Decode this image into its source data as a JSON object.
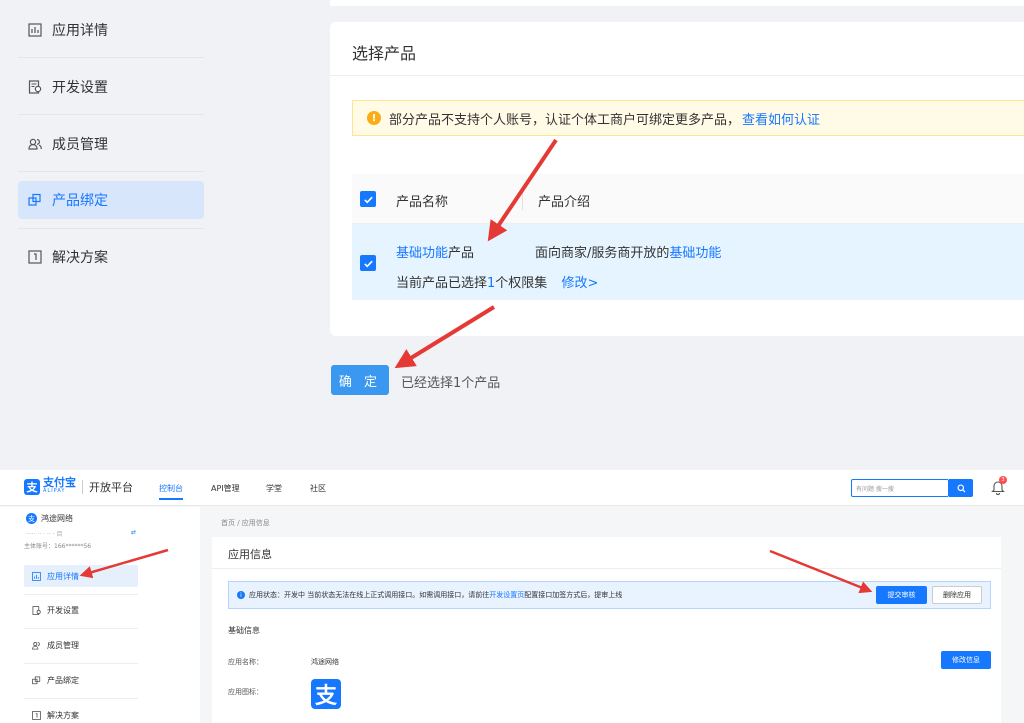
{
  "top": {
    "sidebar": [
      {
        "label": "应用详情",
        "icon": "chart-box-icon",
        "active": false
      },
      {
        "label": "开发设置",
        "icon": "settings-doc-icon",
        "active": false
      },
      {
        "label": "成员管理",
        "icon": "users-icon",
        "active": false
      },
      {
        "label": "产品绑定",
        "icon": "link-copy-icon",
        "active": true
      },
      {
        "label": "解决方案",
        "icon": "solution-box-icon",
        "active": false
      }
    ],
    "panel": {
      "title": "选择产品",
      "notice": {
        "text": "部分产品不支持个人账号，认证个体工商户可绑定更多产品，",
        "link": "查看如何认证"
      },
      "table": {
        "headers": [
          "产品名称",
          "产品介绍"
        ],
        "row": {
          "name_link": "基础功能",
          "name_suffix": "产品",
          "intro_prefix": "面向商家/服务商开放的",
          "intro_link": "基础功能",
          "selected_prefix": "当前产品已选择",
          "selected_count": "1",
          "selected_suffix": "个权限集",
          "modify_link": "修改>"
        }
      }
    },
    "confirm_button": "确 定",
    "selected_tip": "已经选择1个产品"
  },
  "bottom": {
    "logo": {
      "glyph": "支",
      "cn": "支付宝",
      "en": "ALIPAY",
      "platform": "开放平台"
    },
    "nav": [
      "控制台",
      "API管理",
      "学堂",
      "社区"
    ],
    "search_placeholder": "有问题 搜一搜",
    "notification_count": "3",
    "account": {
      "name": "鸿途网络",
      "id_masked": "·····  ·· ·  ·· ·   目",
      "main_account": "主体账号：166******56"
    },
    "sidebar": [
      {
        "label": "应用详情",
        "active": true
      },
      {
        "label": "开发设置",
        "active": false
      },
      {
        "label": "成员管理",
        "active": false
      },
      {
        "label": "产品绑定",
        "active": false
      },
      {
        "label": "解决方案",
        "active": false
      }
    ],
    "breadcrumb": "首页 / 应用信息",
    "card": {
      "title": "应用信息",
      "status_text": "应用状态：开发中 当前状态无法在线上正式调用接口。如需调用接口，请前往",
      "status_link": "开发设置页",
      "status_suffix": "配置接口加签方式后，提审上线",
      "submit_button": "提交审核",
      "delete_button": "删除应用",
      "section_title": "基础信息",
      "app_name_label": "应用名称：",
      "app_name_value": "鸿途网络",
      "app_icon_label": "应用图标：",
      "app_icon_glyph": "支",
      "edit_button": "修改信息"
    }
  },
  "colors": {
    "primary": "#1677ff",
    "warning": "#faad14",
    "arrow": "#e53935",
    "active_bg": "#d7e6fb"
  }
}
